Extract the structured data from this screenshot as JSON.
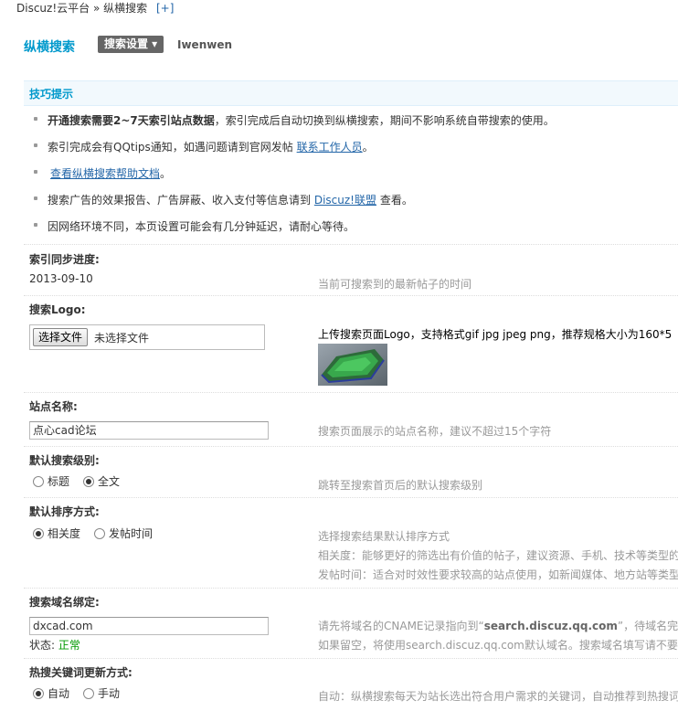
{
  "breadcrumb": {
    "text": "Discuz!云平台 » 纵横搜索",
    "plus": "[+]"
  },
  "header": {
    "title": "纵横搜索",
    "settings_button": "搜索设置 ▾",
    "user": "Iwenwen"
  },
  "tips": {
    "title": "技巧提示",
    "t1_bold": "开通搜索需要2~7天索引站点数据",
    "t1_rest": "，索引完成后自动切换到纵横搜索，期间不影响系统自带搜索的使用。",
    "t2_pre": "索引完成会有QQtips通知，如遇问题请到官网发帖",
    "t2_link": "联系工作人员",
    "t2_post": "。",
    "t3_link": "查看纵横搜索帮助文档",
    "t3_post": "。",
    "t4_pre": "搜索广告的效果报告、广告屏蔽、收入支付等信息请到",
    "t4_link": "Discuz!联盟",
    "t4_post": "查看。",
    "t5": "因网络环境不同，本页设置可能会有几分钟延迟，请耐心等待。"
  },
  "index_progress": {
    "label": "索引同步进度:",
    "value": "2013-09-10",
    "comment": "当前可搜索到的最新帖子的时间"
  },
  "logo": {
    "label": "搜索Logo:",
    "choose_button": "选择文件",
    "no_file": "未选择文件",
    "comment": "上传搜索页面Logo，支持格式gif jpg jpeg png，推荐规格大小为160*5"
  },
  "site_name": {
    "label": "站点名称:",
    "value": "点心cad论坛",
    "comment": "搜索页面展示的站点名称，建议不超过15个字符"
  },
  "search_level": {
    "label": "默认搜索级别:",
    "options": [
      "标题",
      "全文"
    ],
    "selected": "全文",
    "comment": "跳转至搜索首页后的默认搜索级别"
  },
  "sort_mode": {
    "label": "默认排序方式:",
    "options": [
      "相关度",
      "发帖时间"
    ],
    "selected": "相关度",
    "comment1": "选择搜索结果默认排序方式",
    "comment2": "相关度：能够更好的筛选出有价值的帖子，建议资源、手机、技术等类型的",
    "comment3": "发帖时间：适合对时效性要求较高的站点使用，如新闻媒体、地方站等类型"
  },
  "domain_bind": {
    "label": "搜索域名绑定:",
    "value": "dxcad.com",
    "status_label": "状态:",
    "status_value": "正常",
    "comment1_pre": "请先将域名的CNAME记录指向到“",
    "comment1_bold": "search.discuz.qq.com",
    "comment1_post": "”，待域名完全",
    "comment2": "如果留空，将使用search.discuz.qq.com默认域名。搜索域名填写请不要"
  },
  "hotword": {
    "label": "热搜关键词更新方式:",
    "options": [
      "自动",
      "手动"
    ],
    "selected": "自动",
    "comment": "自动：纵横搜索每天为站长选出符合用户需求的关键词，自动推荐到热搜词"
  },
  "colors": {
    "accent": "#0099CC",
    "link": "#2366A8",
    "ok": "#009900",
    "tips_bg": "#F2F9FD"
  }
}
